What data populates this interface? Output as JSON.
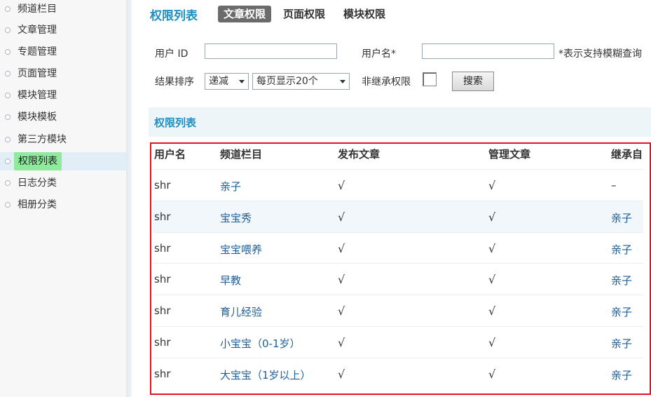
{
  "sidebar": {
    "items": [
      {
        "label": "频道栏目",
        "active": false
      },
      {
        "label": "文章管理",
        "active": false
      },
      {
        "label": "专题管理",
        "active": false
      },
      {
        "label": "页面管理",
        "active": false
      },
      {
        "label": "模块管理",
        "active": false
      },
      {
        "label": "模块模板",
        "active": false
      },
      {
        "label": "第三方模块",
        "active": false
      },
      {
        "label": "权限列表",
        "active": true
      },
      {
        "label": "日志分类",
        "active": false
      },
      {
        "label": "相册分类",
        "active": false
      }
    ]
  },
  "header": {
    "title": "权限列表",
    "tabs": [
      {
        "label": "文章权限",
        "active": true
      },
      {
        "label": "页面权限",
        "active": false
      },
      {
        "label": "模块权限",
        "active": false
      }
    ]
  },
  "form": {
    "user_id_label": "用户 ID",
    "user_id_value": "",
    "username_label": "用户名*",
    "username_value": "",
    "fuzzy_hint": "*表示支持模糊查询",
    "sort_label": "结果排序",
    "sort_value": "递减",
    "page_size_value": "每页显示20个",
    "no_inherit_label": "非继承权限",
    "no_inherit_checked": false,
    "search_button": "搜索"
  },
  "section": {
    "title": "权限列表"
  },
  "table": {
    "headers": [
      "用户名",
      "频道栏目",
      "发布文章",
      "管理文章",
      "继承自"
    ],
    "rows": [
      {
        "user": "shr",
        "channel": "亲子",
        "publish": "√",
        "manage": "√",
        "inherit": "–"
      },
      {
        "user": "shr",
        "channel": "宝宝秀",
        "publish": "√",
        "manage": "√",
        "inherit": "亲子"
      },
      {
        "user": "shr",
        "channel": "宝宝喂养",
        "publish": "√",
        "manage": "√",
        "inherit": "亲子"
      },
      {
        "user": "shr",
        "channel": "早教",
        "publish": "√",
        "manage": "√",
        "inherit": "亲子"
      },
      {
        "user": "shr",
        "channel": "育儿经验",
        "publish": "√",
        "manage": "√",
        "inherit": "亲子"
      },
      {
        "user": "shr",
        "channel": "小宝宝（0-1岁）",
        "publish": "√",
        "manage": "√",
        "inherit": "亲子"
      },
      {
        "user": "shr",
        "channel": "大宝宝（1岁以上）",
        "publish": "√",
        "manage": "√",
        "inherit": "亲子"
      }
    ]
  }
}
